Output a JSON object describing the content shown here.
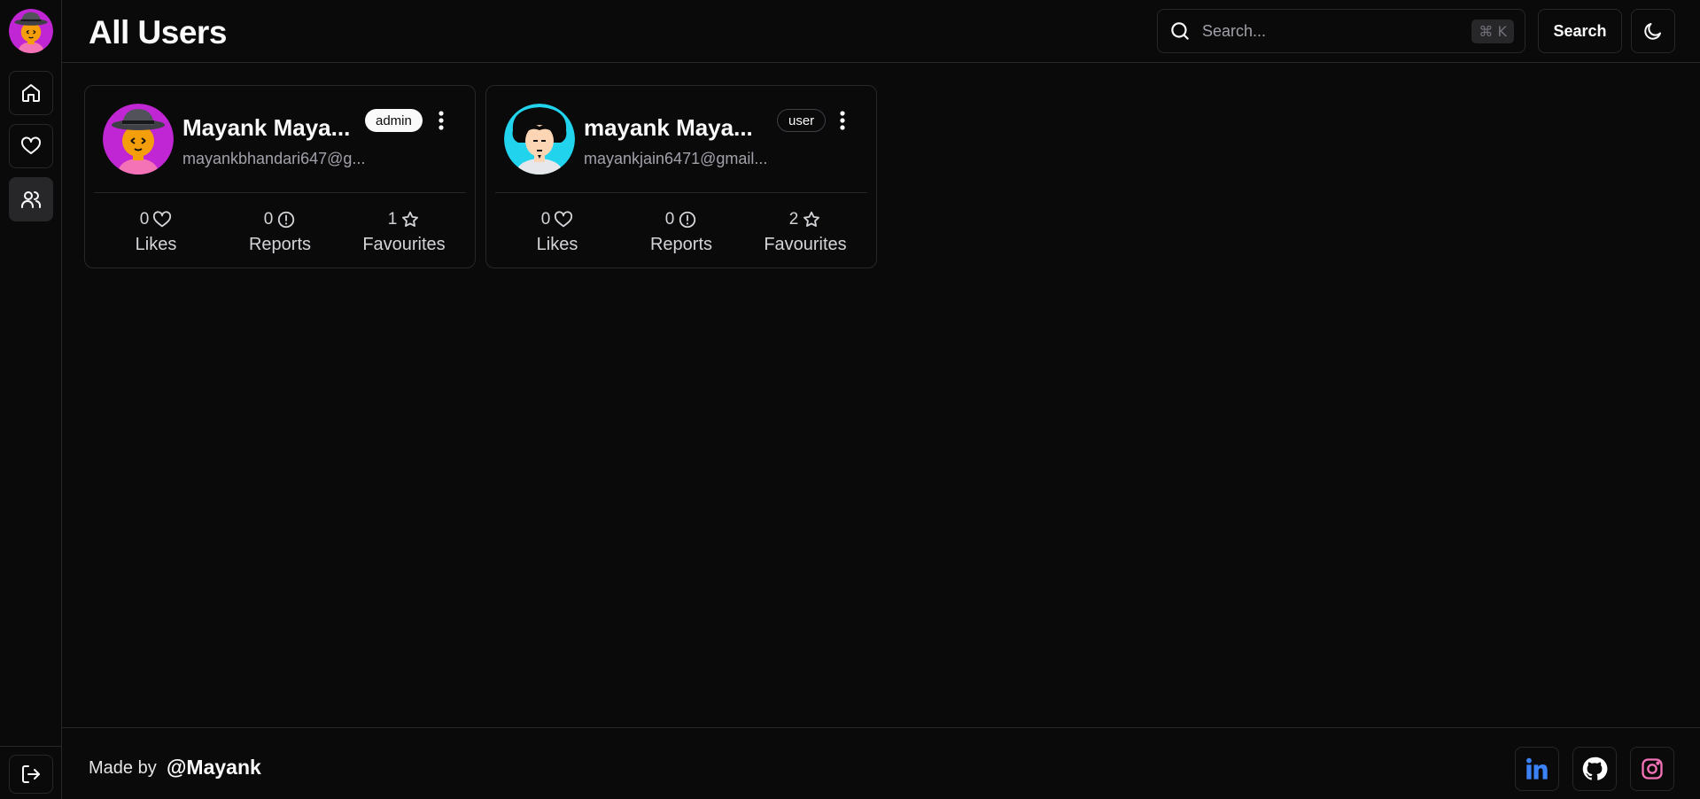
{
  "header": {
    "title": "All Users",
    "search_placeholder": "Search...",
    "shortcut": "⌘ K",
    "search_button": "Search"
  },
  "sidebar": {
    "items": [
      {
        "name": "home",
        "icon": "home-icon"
      },
      {
        "name": "favorites",
        "icon": "heart-icon"
      },
      {
        "name": "users",
        "icon": "users-icon",
        "active": true
      }
    ],
    "logout_icon": "logout-icon"
  },
  "users": [
    {
      "name": "Mayank Maya...",
      "email": "mayankbhandari647@g...",
      "role": "admin",
      "likes": "0",
      "likes_label": "Likes",
      "reports": "0",
      "reports_label": "Reports",
      "favourites": "1",
      "favourites_label": "Favourites"
    },
    {
      "name": "mayank Maya...",
      "email": "mayankjain6471@gmail...",
      "role": "user",
      "likes": "0",
      "likes_label": "Likes",
      "reports": "0",
      "reports_label": "Reports",
      "favourites": "2",
      "favourites_label": "Favourites"
    }
  ],
  "footer": {
    "made_by": "Made by",
    "handle": "@Mayank",
    "socials": [
      {
        "name": "linkedin",
        "icon": "linkedin-icon",
        "color": "#3b82f6"
      },
      {
        "name": "github",
        "icon": "github-icon",
        "color": "#ffffff"
      },
      {
        "name": "instagram",
        "icon": "instagram-icon",
        "color": "#f472b6"
      }
    ]
  },
  "colors": {
    "background": "#0a0a0b",
    "border": "#27272a",
    "muted_text": "#a1a1aa"
  }
}
